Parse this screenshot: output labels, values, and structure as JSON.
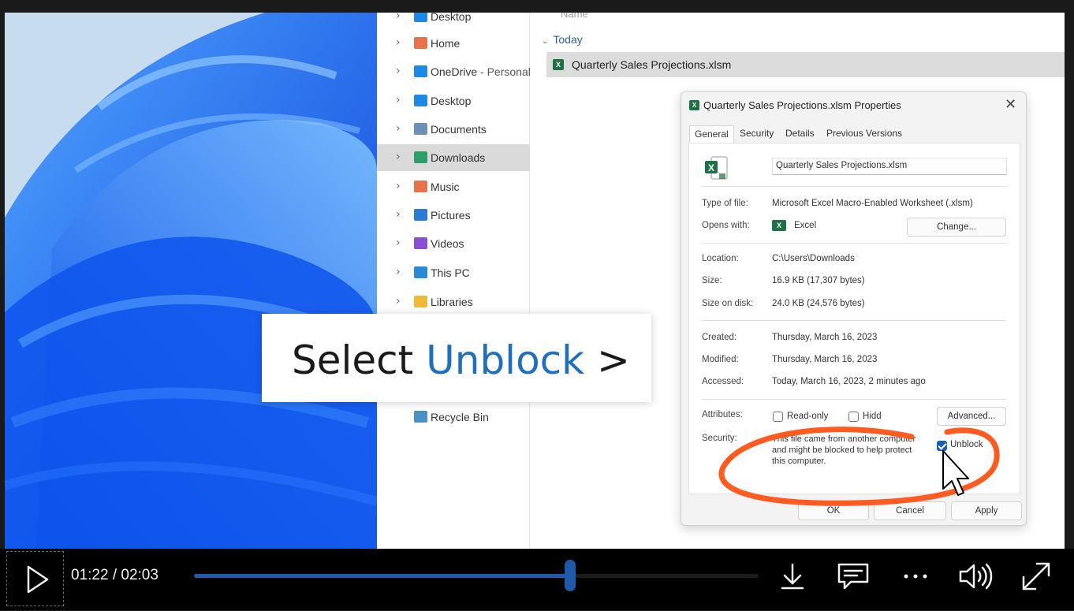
{
  "video": {
    "current_time": "01:22",
    "separator": "/",
    "duration": "02:03",
    "progress": 0.6667
  },
  "explorer": {
    "nav_items": [
      {
        "label": "Desktop",
        "icon": "desktop-folder-icon",
        "color": "#1e88e5"
      },
      {
        "label": "Home",
        "icon": "home-icon",
        "color": "#e8734a"
      },
      {
        "label": "OneDrive",
        "label_suffix": " - Personal",
        "icon": "onedrive-folder-icon",
        "color": "#1e88e5"
      },
      {
        "label": "Desktop",
        "icon": "desktop-folder-icon",
        "color": "#1e88e5"
      },
      {
        "label": "Documents",
        "icon": "documents-folder-icon",
        "color": "#6d8fb8"
      },
      {
        "label": "Downloads",
        "icon": "downloads-folder-icon",
        "color": "#2e9e6a",
        "selected": true
      },
      {
        "label": "Music",
        "icon": "music-folder-icon",
        "color": "#e8734a"
      },
      {
        "label": "Pictures",
        "icon": "pictures-folder-icon",
        "color": "#2b7bd6"
      },
      {
        "label": "Videos",
        "icon": "videos-folder-icon",
        "color": "#8a4fd1"
      },
      {
        "label": "This PC",
        "icon": "this-pc-icon",
        "color": "#2b8ad6"
      },
      {
        "label": "Libraries",
        "icon": "libraries-folder-icon",
        "color": "#f0b93a"
      },
      {
        "label": "Recycle Bin",
        "icon": "recycle-bin-icon",
        "color": "#4a90c8"
      }
    ],
    "column_header": "Name",
    "group_label": "Today",
    "selected_file": "Quarterly Sales Projections.xlsm"
  },
  "dialog": {
    "title": "Quarterly Sales Projections.xlsm Properties",
    "tabs": [
      "General",
      "Security",
      "Details",
      "Previous Versions"
    ],
    "file_name": "Quarterly Sales Projections.xlsm",
    "type_label": "Type of file:",
    "type_value": "Microsoft Excel Macro-Enabled Worksheet (.xlsm)",
    "opens_label": "Opens with:",
    "opens_value": "Excel",
    "change_button": "Change...",
    "location_label": "Location:",
    "location_value": "C:\\Users\\Downloads",
    "size_label": "Size:",
    "size_value": "16.9 KB (17,307 bytes)",
    "size_disk_label": "Size on disk:",
    "size_disk_value": "24.0 KB (24,576 bytes)",
    "created_label": "Created:",
    "created_value": "Thursday, March 16, 2023",
    "modified_label": "Modified:",
    "modified_value": "Thursday, March 16, 2023",
    "accessed_label": "Accessed:",
    "accessed_value": "Today, March 16, 2023, 2 minutes ago",
    "attributes_label": "Attributes:",
    "readonly_label": "Read-only",
    "hidden_label": "Hidd",
    "advanced_button": "Advanced...",
    "security_label": "Security:",
    "security_text": "This file came from another computer and might be blocked to help protect this computer.",
    "unblock_label": "Unblock",
    "unblock_checked": true,
    "ok_button": "OK",
    "cancel_button": "Cancel",
    "apply_button": "Apply"
  },
  "callout": {
    "prefix": "Select ",
    "highlight": "Unblock",
    "suffix": " >",
    "highlight_color": "#1f6fc0"
  },
  "annotation_color": "#ff5a1f",
  "accent_color": "#1e5aa8"
}
